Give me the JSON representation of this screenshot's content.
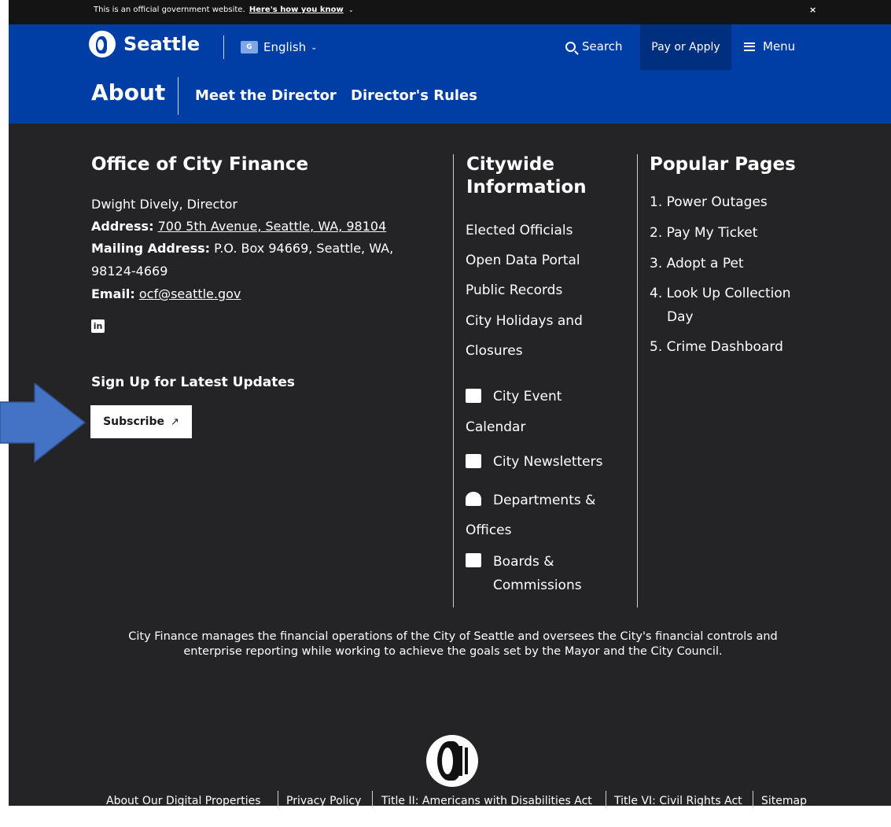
{
  "gov_banner": {
    "text": "This is an official government website.",
    "link": "Here's how you know",
    "close": "×"
  },
  "header": {
    "logo_text": "Seattle",
    "language": "English",
    "search_label": "Search",
    "pay_label": "Pay or Apply",
    "menu_label": "Menu"
  },
  "subnav": {
    "title": "About",
    "links": [
      "Meet the Director",
      "Director's Rules"
    ]
  },
  "office": {
    "heading": "Office of City Finance",
    "director": "Dwight Dively, Director",
    "address_label": "Address:",
    "address_value": "700 5th Avenue, Seattle, WA, 98104",
    "mailing_label": "Mailing Address:",
    "mailing_line1": "P.O. Box 94669, Seattle, WA,",
    "mailing_line2": "98124-4669",
    "email_label": "Email:",
    "email_value": "ocf@seattle.gov",
    "linkedin": "in",
    "signup_heading": "Sign Up for Latest Updates",
    "subscribe_label": "Subscribe",
    "subscribe_icon": "↗"
  },
  "citywide": {
    "heading_line1": "Citywide",
    "heading_line2": "Information",
    "links": [
      "Elected Officials",
      "Open Data Portal",
      "Public Records",
      "City Holidays and",
      "Closures"
    ],
    "icon_links": [
      {
        "icon": "newspaper-icon",
        "line1": "City Event",
        "line2": "Calendar"
      },
      {
        "icon": "calendar-icon",
        "line1": "City Newsletters",
        "line2": ""
      },
      {
        "icon": "envelope-icon",
        "line1": "Departments &",
        "line2": "Offices"
      },
      {
        "icon": "id-card-icon",
        "line1": "Boards &",
        "line2": "Commissions"
      }
    ]
  },
  "popular": {
    "heading": "Popular Pages",
    "items": [
      "1. Power Outages",
      "2. Pay My Ticket",
      "3. Adopt a Pet",
      "4. Look Up Collection",
      "Day",
      "5. Crime Dashboard"
    ]
  },
  "description": "City Finance manages the financial operations of the City of Seattle and oversees the City's financial controls and enterprise reporting while working to achieve the goals set by the Mayor and the City Council.",
  "footer_links": [
    "About Our Digital Properties",
    "Privacy Policy",
    "Title II: Americans with Disabilities Act",
    "Title VI: Civil Rights Act",
    "Sitemap"
  ],
  "colors": {
    "header_blue": "#003da5",
    "footer_bg": "#242426",
    "pay_button": "#002f7f",
    "arrow": "#4472c4"
  }
}
